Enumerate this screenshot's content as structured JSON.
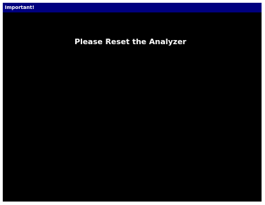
{
  "window": {
    "title": "Important!",
    "message": "Please Reset the Analyzer"
  },
  "colors": {
    "title_bar": "#00007f",
    "background": "#000000",
    "text": "#ffffff"
  }
}
